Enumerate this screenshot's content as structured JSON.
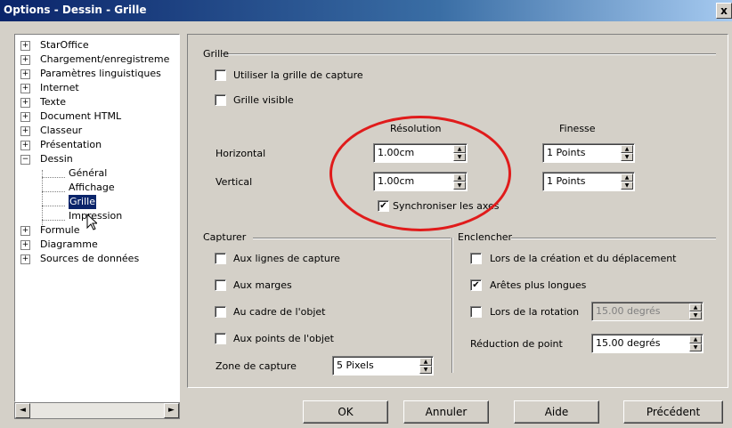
{
  "window": {
    "title": "Options - Dessin - Grille",
    "close_label": "x"
  },
  "tree": {
    "items": [
      {
        "label": "StarOffice",
        "expander": "+"
      },
      {
        "label": "Chargement/enregistreme",
        "expander": "+"
      },
      {
        "label": "Paramètres linguistiques",
        "expander": "+"
      },
      {
        "label": "Internet",
        "expander": "+"
      },
      {
        "label": "Texte",
        "expander": "+"
      },
      {
        "label": "Document HTML",
        "expander": "+"
      },
      {
        "label": "Classeur",
        "expander": "+"
      },
      {
        "label": "Présentation",
        "expander": "+"
      },
      {
        "label": "Dessin",
        "expander": "−"
      },
      {
        "label": "Général",
        "child": true
      },
      {
        "label": "Affichage",
        "child": true
      },
      {
        "label": "Grille",
        "child": true,
        "selected": true
      },
      {
        "label": "Impression",
        "child": true
      },
      {
        "label": "Formule",
        "expander": "+"
      },
      {
        "label": "Diagramme",
        "expander": "+"
      },
      {
        "label": "Sources de données",
        "expander": "+"
      }
    ]
  },
  "grille": {
    "title": "Grille",
    "use_snap_grid": "Utiliser la grille de capture",
    "visible_grid": "Grille visible",
    "resolution_header": "Résolution",
    "finesse_header": "Finesse",
    "horizontal_label": "Horizontal",
    "vertical_label": "Vertical",
    "horizontal_value": "1.00cm",
    "vertical_value": "1.00cm",
    "h_finesse_value": "1 Points",
    "v_finesse_value": "1 Points",
    "sync_axes": "Synchroniser les axes",
    "sync_checked": "✔"
  },
  "capturer": {
    "title": "Capturer",
    "snap_lines": "Aux lignes de capture",
    "margins": "Aux marges",
    "object_frame": "Au cadre de l'objet",
    "object_points": "Aux points de l'objet",
    "zone_label": "Zone de capture",
    "zone_value": "5 Pixels"
  },
  "enclencher": {
    "title": "Enclencher",
    "on_create": "Lors de la création et du déplacement",
    "longer_edges": "Arêtes plus longues",
    "longer_edges_checked": "✔",
    "on_rotation": "Lors de la rotation",
    "rotation_value": "15.00 degrés",
    "point_reduction_label": "Réduction de point",
    "point_reduction_value": "15.00 degrés"
  },
  "buttons": {
    "ok": "OK",
    "cancel": "Annuler",
    "help": "Aide",
    "back": "Précédent"
  },
  "scroll": {
    "left": "◄",
    "right": "►"
  },
  "spin_arrows": {
    "up": "▲",
    "down": "▼"
  },
  "colors": {
    "highlight_oval": "#e01b1b",
    "selection": "#0a246a",
    "dialog_bg": "#d4d0c8"
  }
}
